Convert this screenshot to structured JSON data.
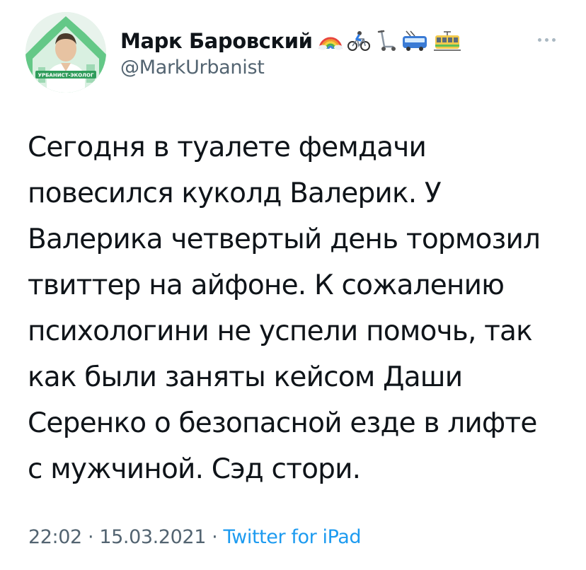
{
  "tweet": {
    "author": {
      "display_name": "Марк Баровский",
      "handle": "@MarkUrbanist",
      "name_emojis": [
        "rainbow-icon",
        "cyclist-icon",
        "kick-scooter-icon",
        "trolleybus-icon",
        "tram-icon"
      ],
      "avatar_badge": "УРБАНИСТ-ЭКОЛОГ"
    },
    "text_lines": [
      "Сегодня в туалете фемдачи",
      "повесился куколд Валерик. У",
      "Валерика четвертый день тормозил",
      "твиттер на айфоне. К сожалению",
      "психологини не успели помочь, так",
      "как были заняты кейсом Даши",
      "Серенко о безопасной езде в лифте",
      "с мужчиной. Сэд стори."
    ],
    "time": "22:02",
    "date": "15.03.2021",
    "separator": "·",
    "source": "Twitter for iPad"
  },
  "colors": {
    "text": "#0f1419",
    "secondary": "#536471",
    "link": "#1d9bf0",
    "avatar_bg": "#e9f5ee",
    "avatar_green": "#3fb56a"
  }
}
